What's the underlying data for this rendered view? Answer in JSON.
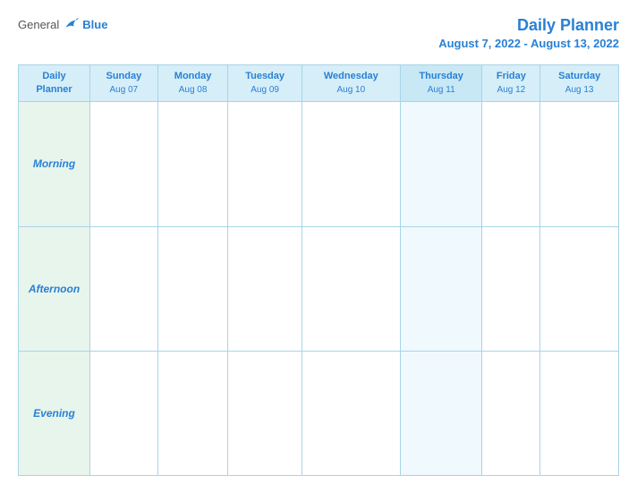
{
  "header": {
    "logo": {
      "general": "General",
      "blue": "Blue"
    },
    "title": "Daily Planner",
    "date_range": "August 7, 2022 - August 13, 2022"
  },
  "columns": [
    {
      "id": "label",
      "day": "Daily\nPlanner",
      "date": ""
    },
    {
      "id": "sun",
      "day": "Sunday",
      "date": "Aug 07"
    },
    {
      "id": "mon",
      "day": "Monday",
      "date": "Aug 08"
    },
    {
      "id": "tue",
      "day": "Tuesday",
      "date": "Aug 09"
    },
    {
      "id": "wed",
      "day": "Wednesday",
      "date": "Aug 10"
    },
    {
      "id": "thu",
      "day": "Thursday",
      "date": "Aug 11"
    },
    {
      "id": "fri",
      "day": "Friday",
      "date": "Aug 12"
    },
    {
      "id": "sat",
      "day": "Saturday",
      "date": "Aug 13"
    }
  ],
  "rows": [
    {
      "id": "morning",
      "label": "Morning"
    },
    {
      "id": "afternoon",
      "label": "Afternoon"
    },
    {
      "id": "evening",
      "label": "Evening"
    }
  ]
}
